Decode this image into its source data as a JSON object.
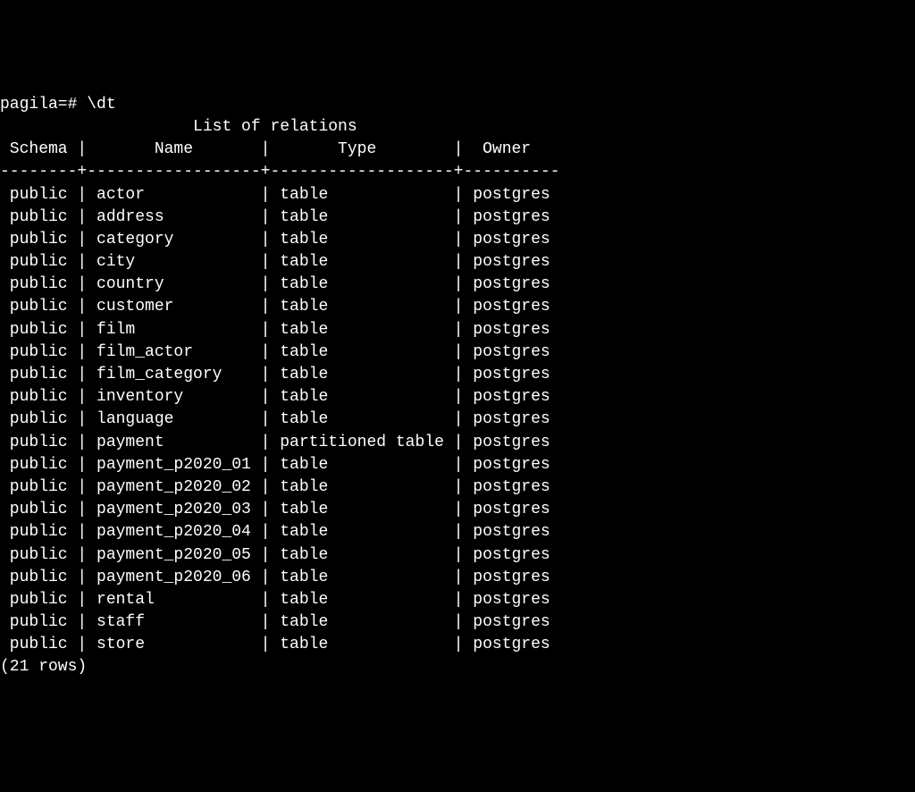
{
  "prompt": "pagila=# ",
  "command": "\\dt",
  "title": "List of relations",
  "headers": {
    "schema": "Schema",
    "name": "Name",
    "type": "Type",
    "owner": "Owner"
  },
  "separator": "--------+------------------+-------------------+----------",
  "rows": [
    {
      "schema": "public",
      "name": "actor",
      "type": "table",
      "owner": "postgres"
    },
    {
      "schema": "public",
      "name": "address",
      "type": "table",
      "owner": "postgres"
    },
    {
      "schema": "public",
      "name": "category",
      "type": "table",
      "owner": "postgres"
    },
    {
      "schema": "public",
      "name": "city",
      "type": "table",
      "owner": "postgres"
    },
    {
      "schema": "public",
      "name": "country",
      "type": "table",
      "owner": "postgres"
    },
    {
      "schema": "public",
      "name": "customer",
      "type": "table",
      "owner": "postgres"
    },
    {
      "schema": "public",
      "name": "film",
      "type": "table",
      "owner": "postgres"
    },
    {
      "schema": "public",
      "name": "film_actor",
      "type": "table",
      "owner": "postgres"
    },
    {
      "schema": "public",
      "name": "film_category",
      "type": "table",
      "owner": "postgres"
    },
    {
      "schema": "public",
      "name": "inventory",
      "type": "table",
      "owner": "postgres"
    },
    {
      "schema": "public",
      "name": "language",
      "type": "table",
      "owner": "postgres"
    },
    {
      "schema": "public",
      "name": "payment",
      "type": "partitioned table",
      "owner": "postgres"
    },
    {
      "schema": "public",
      "name": "payment_p2020_01",
      "type": "table",
      "owner": "postgres"
    },
    {
      "schema": "public",
      "name": "payment_p2020_02",
      "type": "table",
      "owner": "postgres"
    },
    {
      "schema": "public",
      "name": "payment_p2020_03",
      "type": "table",
      "owner": "postgres"
    },
    {
      "schema": "public",
      "name": "payment_p2020_04",
      "type": "table",
      "owner": "postgres"
    },
    {
      "schema": "public",
      "name": "payment_p2020_05",
      "type": "table",
      "owner": "postgres"
    },
    {
      "schema": "public",
      "name": "payment_p2020_06",
      "type": "table",
      "owner": "postgres"
    },
    {
      "schema": "public",
      "name": "rental",
      "type": "table",
      "owner": "postgres"
    },
    {
      "schema": "public",
      "name": "staff",
      "type": "table",
      "owner": "postgres"
    },
    {
      "schema": "public",
      "name": "store",
      "type": "table",
      "owner": "postgres"
    }
  ],
  "footer": "(21 rows)",
  "col_widths": {
    "schema": 8,
    "name": 18,
    "type": 19,
    "owner": 10
  }
}
